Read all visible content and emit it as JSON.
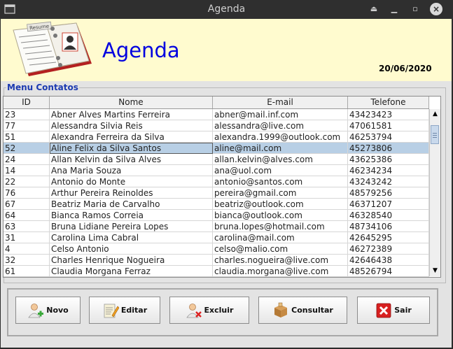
{
  "window": {
    "title": "Agenda"
  },
  "header": {
    "app_name": "Agenda",
    "date": "20/06/2020",
    "logo_tag": "Resume"
  },
  "panel": {
    "title": "Menu Contatos"
  },
  "table": {
    "columns": [
      "ID",
      "Nome",
      "E-mail",
      "Telefone"
    ],
    "selected_row": 3,
    "rows": [
      [
        "23",
        "Abner Alves Martins Ferreira",
        "abner@mail.inf.com",
        "43423423"
      ],
      [
        "77",
        "Alessandra Silvia Reis",
        "alessandra@live.com",
        "47061581"
      ],
      [
        "51",
        "Alexandra Ferreira da Silva",
        "alexandra.1999@outlook.com",
        "46253794"
      ],
      [
        "52",
        "Aline Felix da Silva Santos",
        "aline@mail.com",
        "45273806"
      ],
      [
        "24",
        "Allan Kelvin da Silva Alves",
        "allan.kelvin@alves.com",
        "43625386"
      ],
      [
        "14",
        "Ana Maria Souza",
        "ana@uol.com",
        "46234234"
      ],
      [
        "22",
        "Antonio do Monte",
        "antonio@santos.com",
        "43243242"
      ],
      [
        "76",
        "Arthur Pereira Reinoldes",
        "pereira@gmail.com",
        "48579256"
      ],
      [
        "67",
        "Beatriz Maria de Carvalho",
        "beatriz@outlook.com",
        "46371207"
      ],
      [
        "64",
        "Bianca Ramos Correia",
        "bianca@outlook.com",
        "46328540"
      ],
      [
        "63",
        "Bruna Lidiane Pereira Lopes",
        "bruna.lopes@hotmail.com",
        "48734106"
      ],
      [
        "31",
        "Carolina Lima Cabral",
        "carolina@mail.com",
        "42645295"
      ],
      [
        "4",
        "Celso Antonio",
        "celso@malio.com",
        "46272389"
      ],
      [
        "32",
        "Charles Henrique Nogueira",
        "charles.nogueira@live.com",
        "42646438"
      ],
      [
        "61",
        "Claudia Morgana Ferraz",
        "claudia.morgana@live.com",
        "48526794"
      ]
    ]
  },
  "buttons": {
    "novo": "Novo",
    "editar": "Editar",
    "excluir": "Excluir",
    "consultar": "Consultar",
    "sair": "Sair"
  },
  "colors": {
    "header_bg": "#fffbcf",
    "app_name": "#0000e0",
    "panel_title": "#1c3ab0",
    "selected_row": "#b8cfe5"
  }
}
